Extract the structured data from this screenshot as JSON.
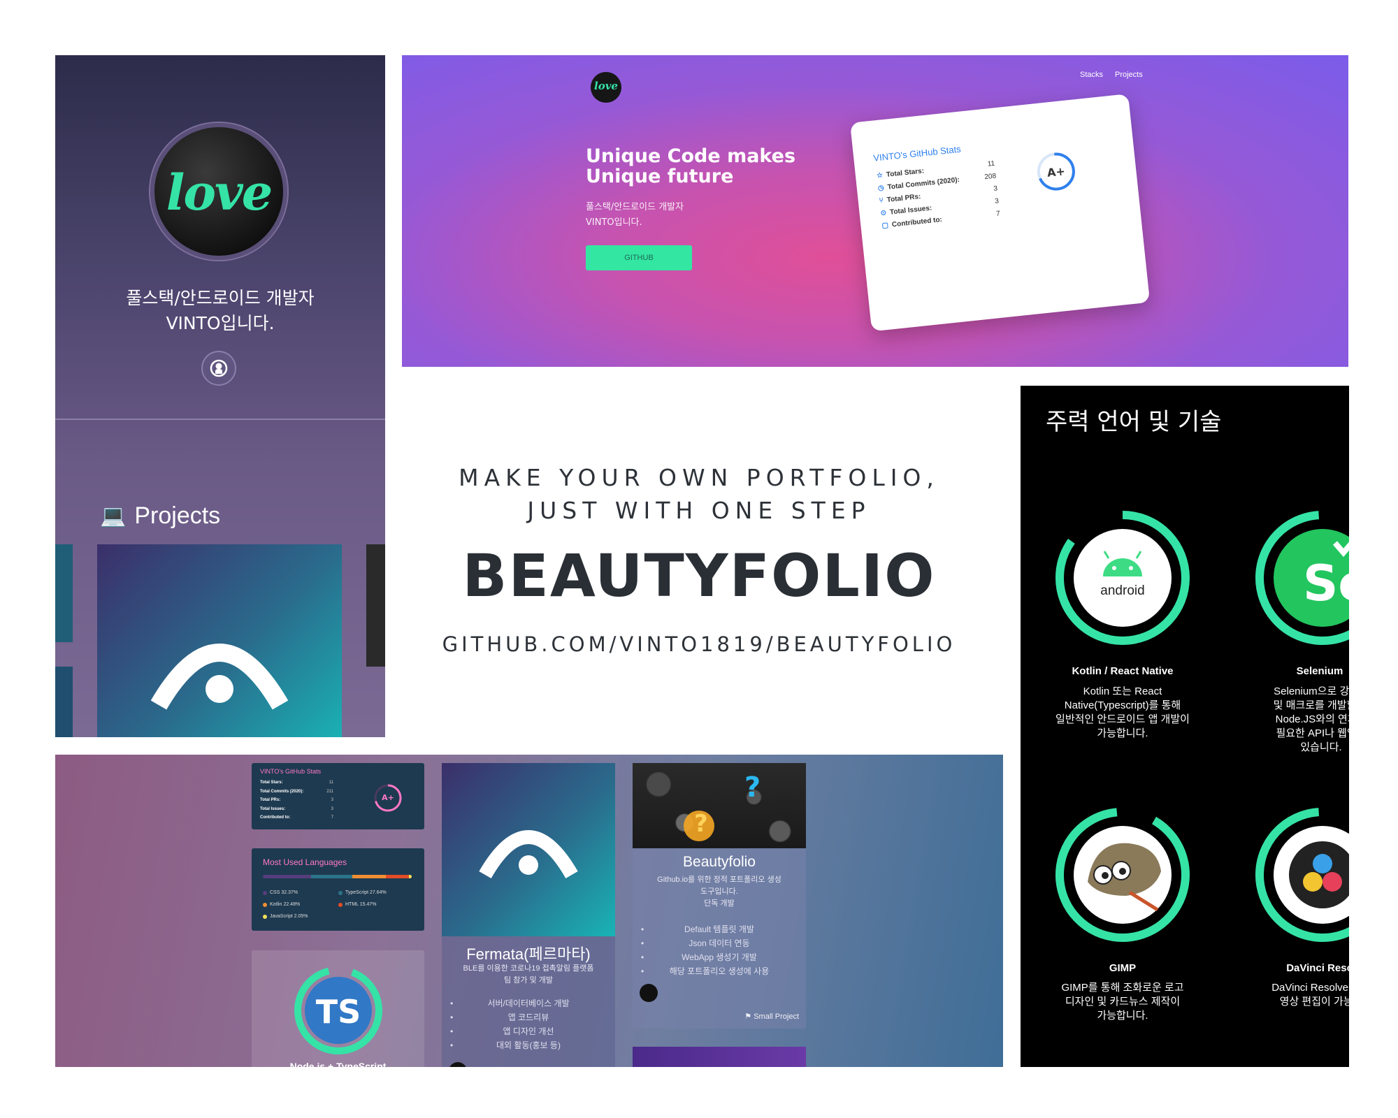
{
  "profile": {
    "logo_text": "love",
    "subtitle_line1": "풀스택/안드로이드 개발자",
    "subtitle_line2": "VINTO입니다.",
    "projects_heading": "Projects",
    "laptop_emoji": "💻"
  },
  "hero": {
    "logo_text": "love",
    "nav": [
      "Stacks",
      "Projects"
    ],
    "title_line1": "Unique Code makes",
    "title_line2": "Unique future",
    "sub_line1": "풀스택/안드로이드 개발자",
    "sub_line2": "VINTO입니다.",
    "button_label": "GITHUB",
    "stats_card": {
      "title": "VINTO's GitHub Stats",
      "rows": [
        {
          "label": "Total Stars:",
          "value": "11"
        },
        {
          "label": "Total Commits (2020):",
          "value": "208"
        },
        {
          "label": "Total PRs:",
          "value": "3"
        },
        {
          "label": "Total Issues:",
          "value": "3"
        },
        {
          "label": "Contributed to:",
          "value": "7"
        }
      ],
      "rank": "A+"
    }
  },
  "center": {
    "tagline_line1": "MAKE YOUR OWN PORTFOLIO,",
    "tagline_line2": "JUST WITH ONE STEP",
    "brand": "BEAUTYFOLIO",
    "url": "GITHUB.COM/VINTO1819/BEAUTYFOLIO"
  },
  "skills": {
    "heading": "주력 언어 및 기술",
    "items": [
      {
        "logo": "android",
        "name": "Kotlin / React Native",
        "desc": [
          "Kotlin 또는 React",
          "Native(Typescript)를 통해",
          "일반적인 안드로이드 앱 개발이",
          "가능합니다."
        ],
        "progress": 0.85
      },
      {
        "logo": "Se",
        "name": "Selenium",
        "desc": [
          "Selenium으로 강력한",
          "및 매크로를 개발할 수",
          "Node.JS와의 연계로",
          "필요한 API나 웹앱도",
          "있습니다."
        ],
        "progress": 0.8
      },
      {
        "logo": "gimp",
        "name": "GIMP",
        "desc": [
          "GIMP를 통해 조화로운 로고",
          "디자인 및 카드뉴스 제작이",
          "가능합니다."
        ],
        "progress": 0.9
      },
      {
        "logo": "davinci",
        "name": "DaVinci Reso",
        "desc": [
          "DaVinci Resolve를 통",
          "영상 편집이 가능합"
        ],
        "progress": 0.8
      }
    ],
    "ring_color": "#35e3a7"
  },
  "collage": {
    "stats": {
      "title": "VINTO's GitHub Stats",
      "rows": [
        {
          "label": "Total Stars:",
          "value": "11"
        },
        {
          "label": "Total Commits (2020):",
          "value": "211"
        },
        {
          "label": "Total PRs:",
          "value": "3"
        },
        {
          "label": "Total Issues:",
          "value": "3"
        },
        {
          "label": "Contributed to:",
          "value": "7"
        }
      ],
      "rank": "A+"
    },
    "languages": {
      "title": "Most Used Languages",
      "items": [
        {
          "name": "CSS 32.37%",
          "pct": 32.37,
          "color": "#563d7c"
        },
        {
          "name": "TypeScript 27.64%",
          "pct": 27.64,
          "color": "#2b7489"
        },
        {
          "name": "Kotlin 22.48%",
          "pct": 22.48,
          "color": "#F18E33"
        },
        {
          "name": "HTML 15.47%",
          "pct": 15.47,
          "color": "#e34c26"
        },
        {
          "name": "JavaScript 2.05%",
          "pct": 2.05,
          "color": "#f1e05a"
        }
      ]
    },
    "ts_card": {
      "logo": "TS",
      "label": "Node.js + TypeScript"
    },
    "fermata": {
      "title": "Fermata(페르마타)",
      "desc": [
        "BLE를 이용한 코로나19 접촉알림 플랫폼",
        "팀 참가 및 개발"
      ],
      "list": [
        "서버/데이터베이스 개발",
        "앱 코드리뷰",
        "앱 디자인 개선",
        "대외 활동(홍보 등)"
      ]
    },
    "beautyfolio": {
      "title": "Beautyfolio",
      "desc": [
        "Github.io를 위한 정적 포트폴리오 생성",
        "도구입니다."
      ],
      "role": "단독 개발",
      "list": [
        "Default 템플릿 개발",
        "Json 데이터 연동",
        "WebApp 생성기 개발",
        "해당 포트폴리오 생성에 사용"
      ],
      "badge": "Small Project"
    }
  }
}
